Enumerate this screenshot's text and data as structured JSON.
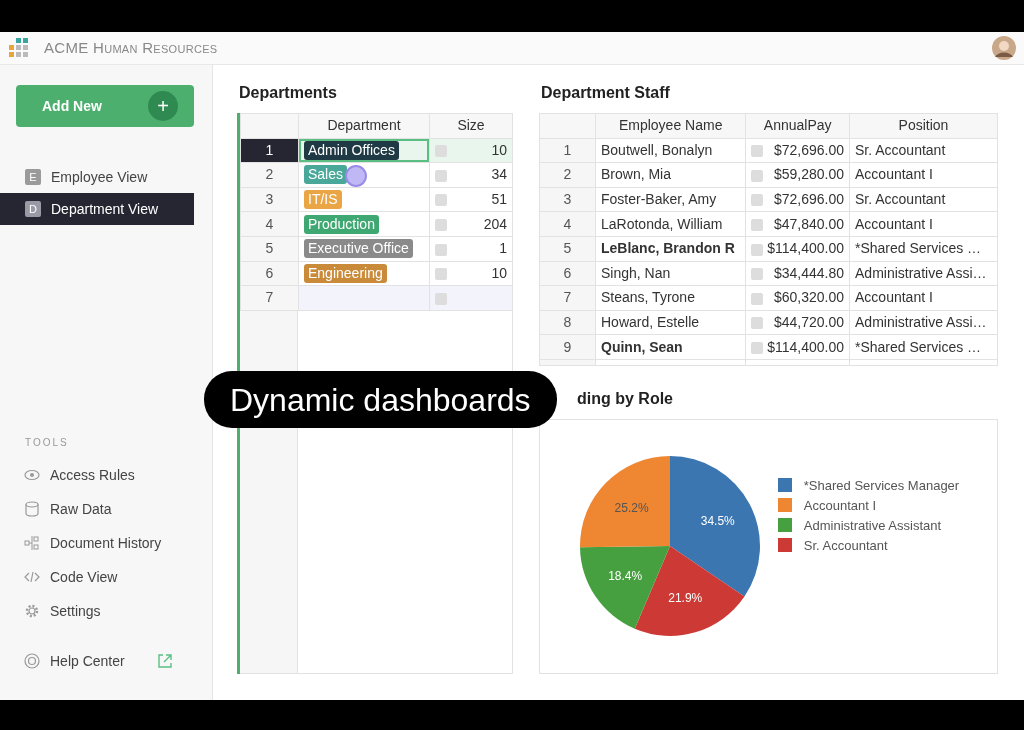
{
  "app": {
    "title": "ACME Human Resources"
  },
  "sidebar": {
    "add_button": "Add New",
    "add_icon": "+",
    "views": [
      {
        "letter": "E",
        "label": "Employee View",
        "selected": false
      },
      {
        "letter": "D",
        "label": "Department View",
        "selected": true
      }
    ],
    "tools_heading": "TOOLS",
    "tools": [
      {
        "kind": "eye",
        "label": "Access Rules"
      },
      {
        "kind": "cylinder",
        "label": "Raw Data"
      },
      {
        "kind": "history",
        "label": "Document History"
      },
      {
        "kind": "code",
        "label": "Code View"
      },
      {
        "kind": "gear",
        "label": "Settings"
      }
    ],
    "help": {
      "label": "Help Center"
    }
  },
  "departments": {
    "title": "Departments",
    "columns": [
      "Department",
      "Size"
    ],
    "rows": [
      {
        "num": "1",
        "name": "Admin Offices",
        "color": "#1f3a44",
        "size": "10",
        "selected": true
      },
      {
        "num": "2",
        "name": "Sales",
        "color": "#4aa89a",
        "size": "34",
        "selected": false
      },
      {
        "num": "3",
        "name": "IT/IS",
        "color": "#eaa545",
        "size": "51",
        "selected": false
      },
      {
        "num": "4",
        "name": "Production",
        "color": "#3fa872",
        "size": "204",
        "selected": false
      },
      {
        "num": "5",
        "name": "Executive Office",
        "color": "#8a8a8a",
        "size": "1",
        "selected": false
      },
      {
        "num": "6",
        "name": "Engineering",
        "color": "#c98a3a",
        "size": "10",
        "selected": false
      },
      {
        "num": "7",
        "selected": false
      }
    ]
  },
  "staff": {
    "title": "Department Staff",
    "columns": [
      "Employee Name",
      "AnnualPay",
      "Position"
    ],
    "rows": [
      {
        "num": "1",
        "name": "Boutwell, Bonalyn",
        "pay": "$72,696.00",
        "position": "Sr. Accountant",
        "bold": false
      },
      {
        "num": "2",
        "name": "Brown, Mia",
        "pay": "$59,280.00",
        "position": "Accountant I",
        "bold": false
      },
      {
        "num": "3",
        "name": "Foster-Baker, Amy",
        "pay": "$72,696.00",
        "position": "Sr. Accountant",
        "bold": false
      },
      {
        "num": "4",
        "name": "LaRotonda, William",
        "pay": "$47,840.00",
        "position": "Accountant I",
        "bold": false
      },
      {
        "num": "5",
        "name": "LeBlanc, Brandon R",
        "pay": "$114,400.00",
        "position": "*Shared Services …",
        "bold": true
      },
      {
        "num": "6",
        "name": "Singh, Nan",
        "pay": "$34,444.80",
        "position": "Administrative Assi…",
        "bold": false
      },
      {
        "num": "7",
        "name": "Steans, Tyrone",
        "pay": "$60,320.00",
        "position": "Accountant I",
        "bold": false
      },
      {
        "num": "8",
        "name": "Howard, Estelle",
        "pay": "$44,720.00",
        "position": "Administrative Assi…",
        "bold": false
      },
      {
        "num": "9",
        "name": "Quinn, Sean",
        "pay": "$114,400.00",
        "position": "*Shared Services …",
        "bold": true
      }
    ]
  },
  "funding": {
    "title": "ding by Role",
    "chart_data": {
      "type": "pie",
      "categories": [
        "*Shared Services Manager",
        "Accountant I",
        "Administrative Assistant",
        "Sr. Accountant"
      ],
      "values": [
        34.5,
        25.2,
        18.4,
        21.9
      ],
      "colors": [
        "#3b76b1",
        "#ee8632",
        "#46a03f",
        "#cd3a36"
      ],
      "value_labels": [
        "34.5%",
        "25.2%",
        "18.4%",
        "21.9%"
      ],
      "legend": "right"
    }
  },
  "caption": "Dynamic dashboards"
}
